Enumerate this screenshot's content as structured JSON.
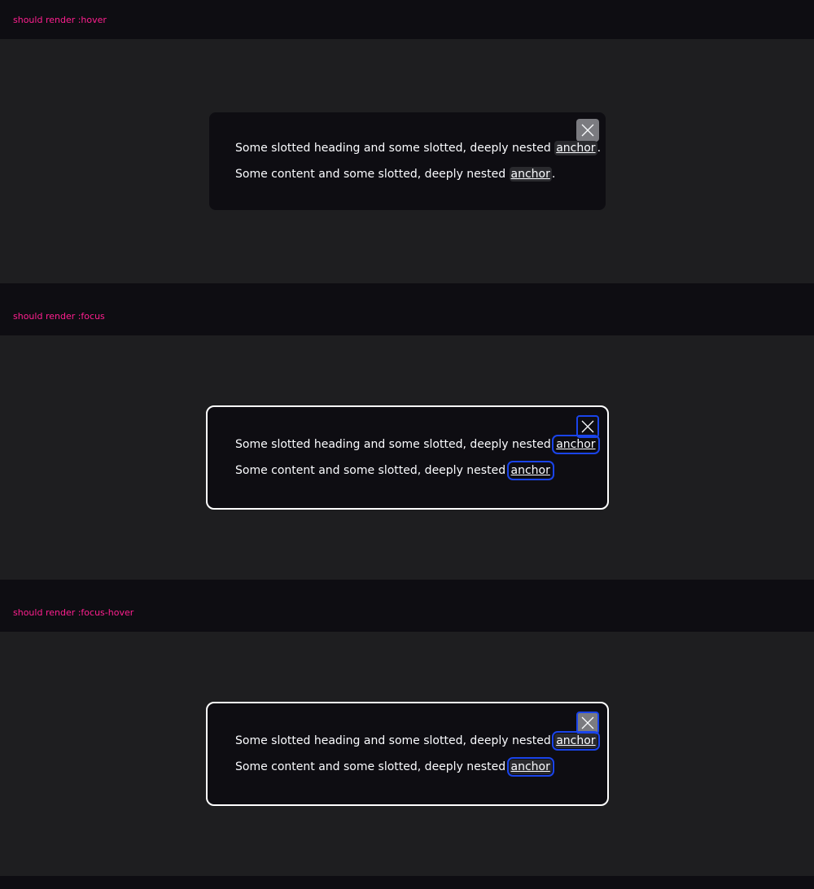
{
  "sections": [
    {
      "title": "should render :hover",
      "line1_text": "Some slotted heading and some slotted, deeply nested ",
      "line2_text": "Some content and some slotted, deeply nested ",
      "anchor_label": "anchor",
      "period": "."
    },
    {
      "title": "should render :focus",
      "line1_text": "Some slotted heading and some slotted, deeply nested ",
      "line2_text": "Some content and some slotted, deeply nested ",
      "anchor_label": "anchor",
      "period": "."
    },
    {
      "title": "should render :focus-hover",
      "line1_text": "Some slotted heading and some slotted, deeply nested ",
      "line2_text": "Some content and some slotted, deeply nested ",
      "anchor_label": "anchor",
      "period": "."
    }
  ],
  "icons": {
    "close": "close-icon"
  },
  "colors": {
    "title": "#ff1f8f",
    "focus_ring": "#1a44ea",
    "hover_bg": "#7b7b80",
    "stage_bg": "#1e1e20",
    "modal_bg": "#0e0d12"
  }
}
